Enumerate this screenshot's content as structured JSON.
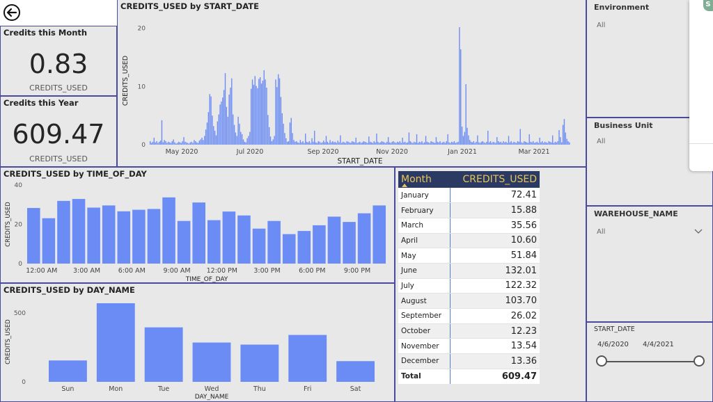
{
  "header": {
    "back_icon": "back-arrow-icon"
  },
  "cards": {
    "month": {
      "title": "Credits this Month",
      "value": "0.83",
      "label": "CREDITS_USED"
    },
    "year": {
      "title": "Credits this Year",
      "value": "609.47",
      "label": "CREDITS_USED"
    }
  },
  "chart_data": [
    {
      "type": "bar",
      "title": "CREDITS_USED by START_DATE",
      "xlabel": "START_DATE",
      "ylabel": "CREDITS_USED",
      "ylim": [
        0,
        22
      ],
      "yticks": [
        "0",
        "10",
        "20"
      ],
      "xtick_labels": [
        "May 2020",
        "Jul 2020",
        "Sep 2020",
        "Nov 2020",
        "Jan 2021",
        "Mar 2021"
      ],
      "x_range": [
        "2020-04-06",
        "2021-04-04"
      ],
      "values": [
        0.6,
        0.3,
        0.5,
        1.2,
        0.4,
        0.6,
        0.3,
        0.5,
        0.7,
        4.2,
        0.4,
        0.8,
        0.6,
        0.3,
        0.5,
        0.4,
        0.3,
        0.6,
        0.9,
        0.4,
        0.2,
        0.3,
        0.5,
        0.4,
        0.3,
        0.6,
        1.3,
        0.5,
        0.4,
        0.3,
        0.2,
        0.4,
        0.5,
        0.3,
        0.8,
        0.6,
        0.4,
        0.3,
        0.7,
        0.9,
        1.2,
        0.8,
        1.5,
        2.6,
        3.8,
        5.6,
        8.7,
        8.3,
        5.0,
        3.2,
        2.4,
        1.6,
        4.0,
        5.2,
        6.9,
        7.4,
        8.1,
        9.4,
        12.3,
        6.5,
        4.8,
        8.6,
        9.8,
        11.4,
        5.2,
        3.4,
        2.1,
        1.5,
        4.8,
        3.6,
        2.2,
        1.8,
        0.9,
        0.5,
        0.4,
        1.1,
        1.5,
        2.2,
        9.6,
        11.2,
        10.3,
        11.8,
        10.1,
        9.7,
        11.3,
        11.6,
        10.5,
        11.0,
        12.8,
        11.2,
        9.8,
        5.1,
        3.0,
        1.4,
        0.6,
        0.9,
        1.5,
        11.2,
        9.9,
        12.1,
        11.4,
        8.2,
        5.4,
        3.6,
        2.0,
        1.1,
        0.5,
        0.6,
        3.8,
        4.6,
        2.0,
        0.8,
        0.5,
        0.6,
        0.4,
        0.3,
        0.8,
        0.4,
        0.6,
        0.3,
        1.9,
        0.5,
        0.4,
        0.6,
        0.3,
        1.1,
        0.5,
        2.4,
        0.4,
        0.3,
        0.6,
        0.5,
        0.3,
        0.4,
        0.7,
        0.4,
        1.5,
        0.5,
        0.3,
        0.8,
        0.4,
        0.6,
        0.4,
        0.5,
        0.3,
        0.7,
        0.4,
        1.6,
        0.3,
        0.5,
        0.4,
        0.3,
        0.6,
        0.5,
        0.4,
        0.3,
        0.6,
        0.5,
        0.4,
        1.2,
        0.3,
        0.4,
        0.5,
        0.3,
        0.4,
        0.6,
        0.5,
        0.4,
        0.3,
        1.4,
        0.5,
        0.4,
        0.3,
        0.6,
        0.4,
        1.9,
        0.5,
        0.3,
        0.4,
        0.6,
        0.5,
        0.4,
        0.3,
        0.5,
        1.3,
        0.4,
        0.3,
        0.5,
        0.6,
        0.4,
        0.3,
        0.5,
        0.4,
        0.6,
        0.3,
        1.2,
        0.4,
        0.5,
        0.3,
        0.4,
        2.1,
        0.6,
        0.4,
        0.3,
        0.5,
        0.4,
        1.8,
        0.3,
        0.5,
        0.4,
        0.6,
        0.3,
        0.4,
        1.5,
        0.5,
        0.4,
        0.3,
        0.6,
        0.5,
        0.4,
        0.3,
        1.3,
        0.5,
        0.4,
        0.6,
        0.3,
        0.4,
        0.5,
        0.3,
        0.6,
        1.8,
        0.4,
        0.3,
        0.5,
        0.4,
        0.6,
        0.3,
        0.4,
        0.5,
        20.2,
        16.4,
        3.1,
        1.5,
        2.2,
        10.4,
        2.9,
        1.6,
        0.8,
        0.5,
        0.4,
        0.6,
        0.3,
        0.5,
        1.6,
        0.4,
        0.3,
        0.5,
        0.6,
        0.4,
        0.3,
        0.5,
        2.4,
        0.4,
        0.6,
        0.3,
        0.5,
        0.4,
        0.3,
        1.3,
        0.6,
        0.4,
        0.5,
        0.3,
        0.6,
        0.4,
        0.5,
        0.3,
        1.5,
        0.4,
        0.6,
        0.3,
        0.5,
        0.4,
        0.3,
        0.6,
        0.5,
        2.7,
        0.4,
        0.3,
        0.6,
        0.5,
        0.4,
        0.3,
        1.8,
        0.5,
        0.4,
        0.6,
        0.3,
        0.4,
        0.5,
        0.3,
        1.2,
        0.4,
        0.6,
        0.3,
        0.5,
        0.4,
        0.3,
        0.6,
        0.5,
        0.4,
        1.6,
        0.3,
        0.5,
        0.4,
        0.6,
        2.5,
        1.3,
        0.4,
        3.4,
        4.4,
        2.1,
        1.0,
        0.6,
        0.4
      ]
    },
    {
      "type": "bar",
      "title": "CREDITS_USED by TIME_OF_DAY",
      "xlabel": "TIME_OF_DAY",
      "ylabel": "CREDITS_USED",
      "ylim": [
        0,
        40
      ],
      "yticks": [
        "0",
        "20",
        "40"
      ],
      "xtick_labels": [
        "12:00 AM",
        "3:00 AM",
        "6:00 AM",
        "9:00 AM",
        "12:00 PM",
        "3:00 PM",
        "6:00 PM",
        "9:00 PM"
      ],
      "values": [
        28.3,
        23.1,
        31.9,
        32.9,
        28.5,
        29.6,
        26.6,
        27.4,
        27.8,
        33.7,
        21.7,
        31.1,
        22.1,
        26.5,
        24.5,
        17.8,
        21.7,
        15.0,
        16.6,
        19.5,
        23.9,
        21.2,
        25.6,
        29.6
      ]
    },
    {
      "type": "bar",
      "title": "CREDITS_USED by DAY_NAME",
      "xlabel": "DAY_NAME",
      "ylabel": "CREDITS_USED",
      "ylim": [
        0,
        580
      ],
      "yticks": [
        "0",
        "500"
      ],
      "categories": [
        "Sun",
        "Mon",
        "Tue",
        "Wed",
        "Thu",
        "Fri",
        "Sat"
      ],
      "values": [
        155,
        570,
        395,
        285,
        270,
        340,
        150
      ]
    },
    {
      "type": "table",
      "columns": [
        "Month",
        "CREDITS_USED"
      ],
      "rows": [
        [
          "January",
          "72.41"
        ],
        [
          "February",
          "15.88"
        ],
        [
          "March",
          "35.56"
        ],
        [
          "April",
          "10.60"
        ],
        [
          "May",
          "51.84"
        ],
        [
          "June",
          "132.01"
        ],
        [
          "July",
          "122.32"
        ],
        [
          "August",
          "103.70"
        ],
        [
          "September",
          "26.02"
        ],
        [
          "October",
          "12.23"
        ],
        [
          "November",
          "13.54"
        ],
        [
          "December",
          "13.36"
        ]
      ],
      "total": [
        "Total",
        "609.47"
      ]
    }
  ],
  "slicers": {
    "environment": {
      "title": "Environment",
      "value": "All"
    },
    "business_unit": {
      "title": "Business Unit",
      "value": "All"
    },
    "warehouse": {
      "title": "WAREHOUSE_NAME",
      "value": "All"
    },
    "start_date": {
      "title": "START_DATE",
      "from": "4/6/2020",
      "to": "4/4/2021"
    }
  },
  "overlay": {
    "badge_text": "S"
  },
  "colors": {
    "bar": "#6b8cf5",
    "header_bg": "#2b3a62",
    "header_text": "#e8c55a",
    "border": "#4a4a9c"
  }
}
